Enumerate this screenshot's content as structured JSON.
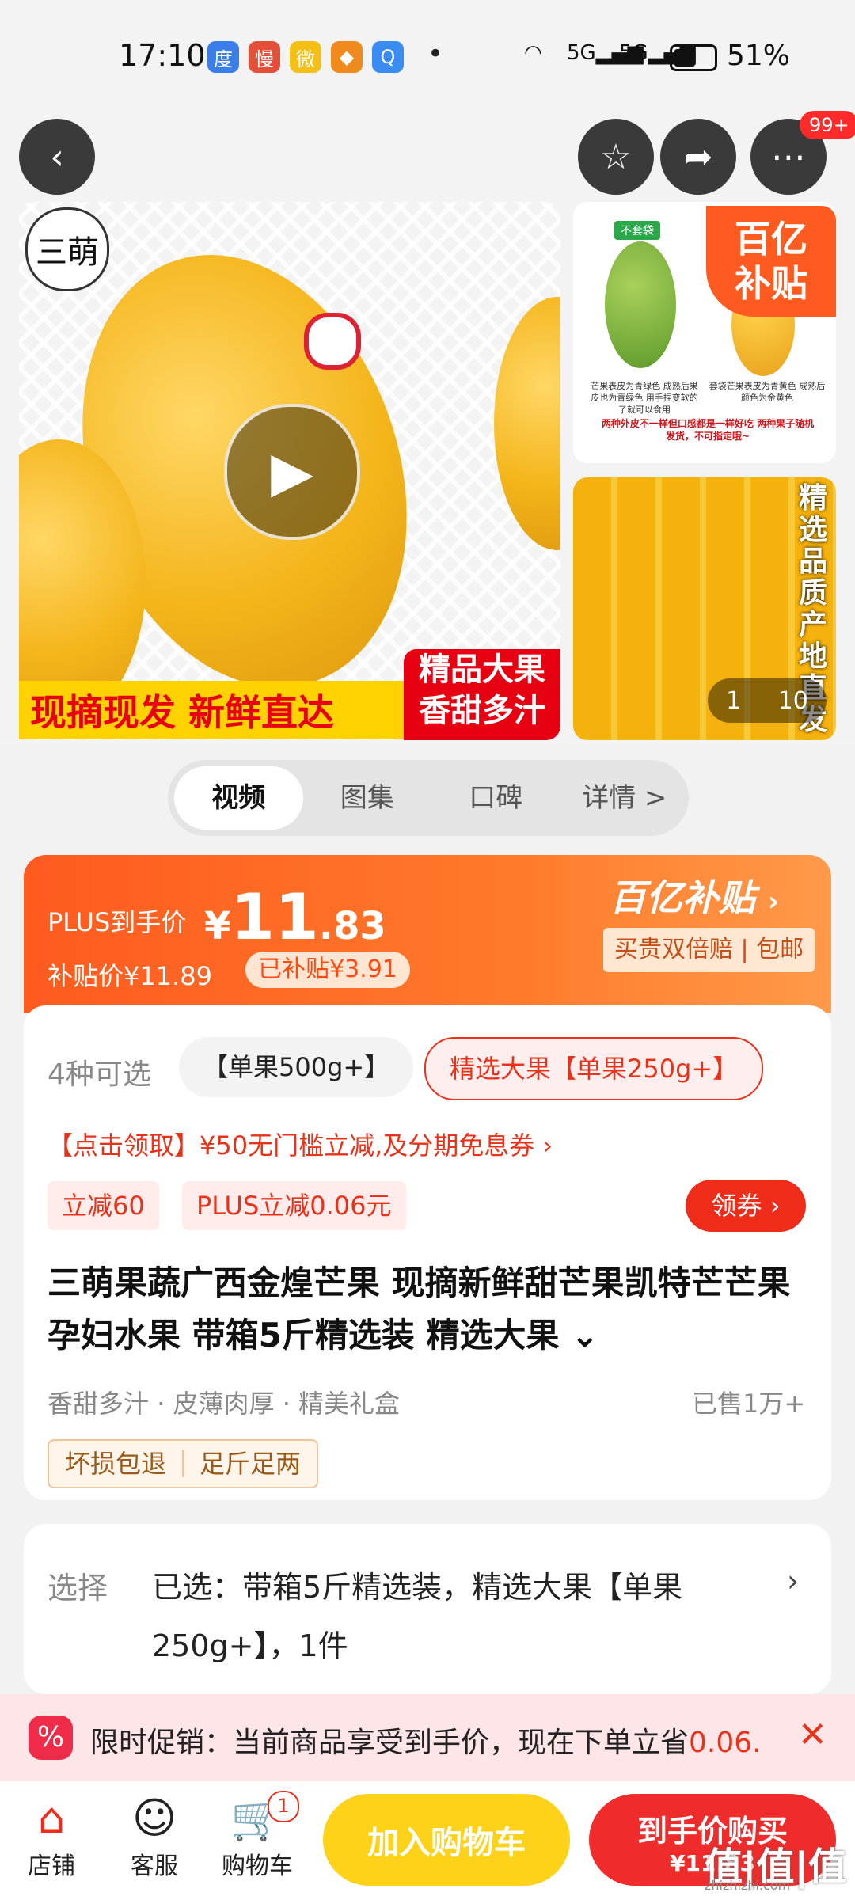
{
  "status_bar": {
    "time": "17:10",
    "battery": "51%",
    "signal1": "5G",
    "signal2": "5G",
    "app_icons": [
      "baidu-icon",
      "manhua-icon",
      "weibo-icon",
      "app-icon",
      "search-app-icon"
    ]
  },
  "nav": {
    "badge": "99+"
  },
  "gallery": {
    "banner_left": "现摘现发 新鲜直达",
    "banner_right_line1": "精品大果",
    "banner_right_line2": "香甜多汁",
    "logo_text": "三萌",
    "subsidy_line1": "百亿",
    "subsidy_line2": "补贴",
    "thumb1_tag": "不套袋",
    "thumb1_left_caption": "芒果表皮为青绿色 成熟后果皮也为青绿色 用手捏变软的了就可以食用",
    "thumb1_right_caption": "套袋芒果表皮为青黄色 成熟后颜色为金黄色",
    "thumb1_note": "两种外皮不一样但口感都是一样好吃 两种果子随机发货，不可指定哦~",
    "vertical_text": "精选品质产地直发",
    "counter_current": "1",
    "counter_total": "10"
  },
  "tabs": [
    "视频",
    "图集",
    "口碑",
    "详情 >"
  ],
  "price": {
    "plus_label": "PLUS到手价",
    "currency": "¥",
    "big_int": "11",
    "big_dec": ".83",
    "subsidy_price": "补贴价¥11.89",
    "subsidized": "已补贴¥3.91",
    "brand": "百亿补贴",
    "guarantee": "买贵双倍赔 | 包邮"
  },
  "options": {
    "count": "4种可选",
    "chip1": "【单果500g+】",
    "chip2": "精选大果【单果250g+】"
  },
  "coupon_line": "【点击领取】¥50无门槛立减,及分期免息券 ›",
  "tags": [
    "立减60",
    "PLUS立减0.06元"
  ],
  "claim_button": "领券",
  "title": "三萌果蔬广西金煌芒果 现摘新鲜甜芒果凯特芒芒果孕妇水果 带箱5斤精选装 精选大果",
  "features": "香甜多汁 · 皮薄肉厚 · 精美礼盒",
  "sold": "已售1万+",
  "pledges": [
    "坏损包退",
    "足斤足两"
  ],
  "selection": {
    "label": "选择",
    "text": "已选：带箱5斤精选装，精选大果【单果250g+】，1件"
  },
  "promo": {
    "text_prefix": "限时促销：当前商品享受到手价，现在下单立省",
    "text_amount": "0.06..."
  },
  "bottom": {
    "shop": "店铺",
    "service": "客服",
    "cart": "购物车",
    "cart_badge": "1",
    "add_to_cart": "加入购物车",
    "buy_now": "到手价购买",
    "buy_price": "¥11.83"
  },
  "watermark": "值|值|值",
  "watermark_url": "zhizhizhi.com",
  "colors": {
    "accent": "#ef2b1a",
    "price_orange": "#ff5a1f",
    "cart_yellow": "#ffd21a"
  }
}
